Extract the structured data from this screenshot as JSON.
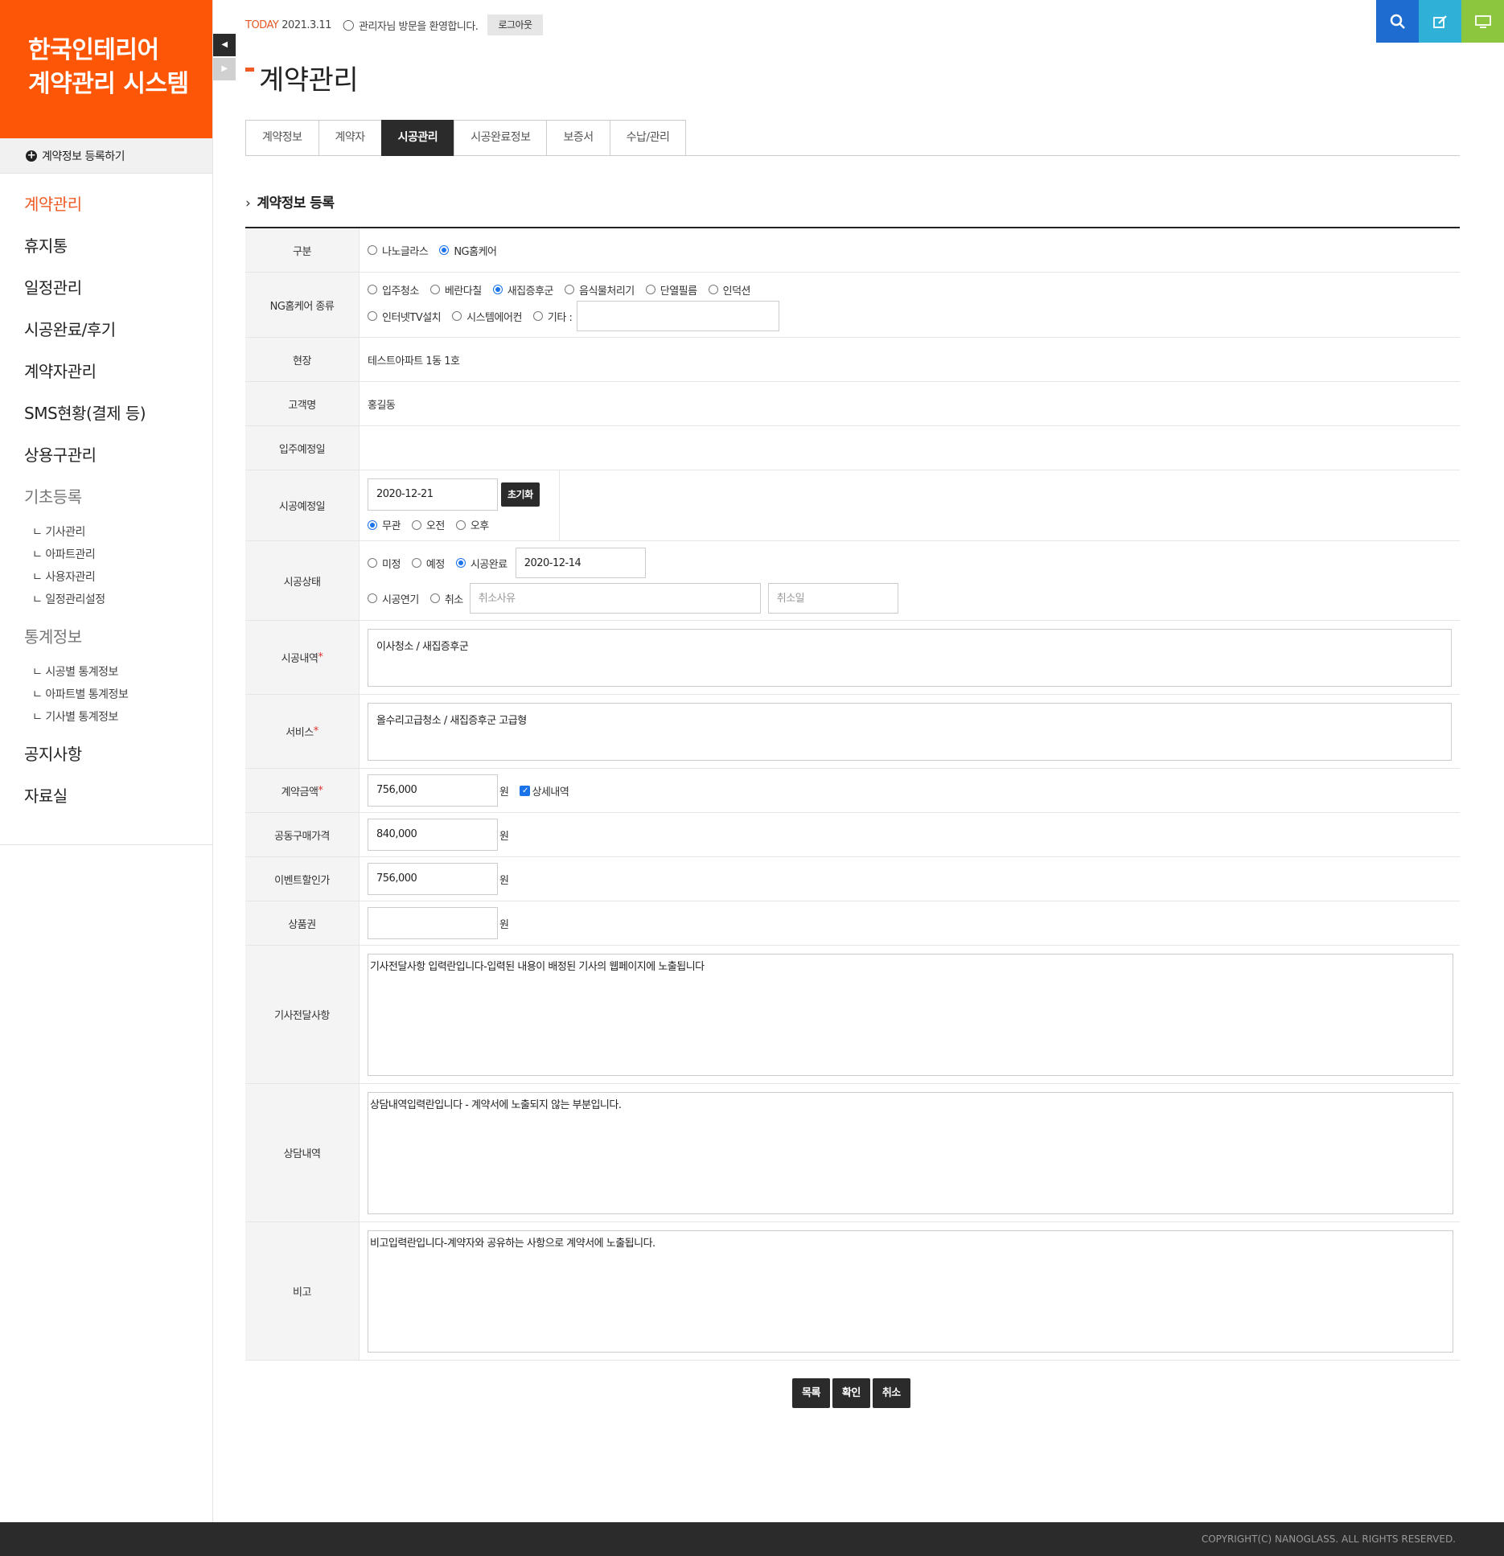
{
  "brand": {
    "line1": "한국인테리어",
    "line2": "계약관리 시스템"
  },
  "sidebar": {
    "register": "계약정보 등록하기",
    "items": [
      {
        "label": "계약관리"
      },
      {
        "label": "휴지통"
      },
      {
        "label": "일정관리"
      },
      {
        "label": "시공완료/후기"
      },
      {
        "label": "계약자관리"
      },
      {
        "label": "SMS현황(결제 등)"
      },
      {
        "label": "상용구관리"
      },
      {
        "label": "기초등록"
      }
    ],
    "basic_sub": [
      "ㄴ 기사관리",
      "ㄴ 아파트관리",
      "ㄴ 사용자관리",
      "ㄴ 일정관리설정"
    ],
    "stats": "통계정보",
    "stats_sub": [
      "ㄴ 시공별 통계정보",
      "ㄴ 아파트별 통계정보",
      "ㄴ 기사별 통계정보"
    ],
    "notice": "공지사항",
    "archive": "자료실"
  },
  "topbar": {
    "today_label": "TODAY",
    "date": "2021.3.11",
    "welcome": "관리자님 방문을 환영합니다.",
    "logout": "로그아웃"
  },
  "page_title": "계약관리",
  "tabs": [
    "계약정보",
    "계약자",
    "시공관리",
    "시공완료정보",
    "보증서",
    "수납/관리"
  ],
  "section_title": "계약정보 등록",
  "form": {
    "type": {
      "label": "구분",
      "opt1": "나노글라스",
      "opt2": "NG홈케어"
    },
    "ng_type": {
      "label": "NG홈케어 종류",
      "opts": [
        "입주청소",
        "베란다칠",
        "새집증후군",
        "음식물처리기",
        "단열필름",
        "인덕션",
        "인터넷TV설치",
        "시스템에어컨",
        "기타 :"
      ]
    },
    "site": {
      "label": "현장",
      "value": "테스트아파트 1동 1호"
    },
    "customer": {
      "label": "고객명",
      "value": "홍길동"
    },
    "move_in": {
      "label": "입주예정일"
    },
    "schedule": {
      "label": "시공예정일",
      "date": "2020-12-21",
      "reset": "초기화",
      "opts": [
        "무관",
        "오전",
        "오후"
      ]
    },
    "status": {
      "label": "시공상태",
      "opts": [
        "미정",
        "예정",
        "시공완료",
        "시공연기",
        "취소"
      ],
      "done_date": "2020-12-14",
      "cancel_reason_ph": "취소사유",
      "cancel_date_ph": "취소일"
    },
    "work": {
      "label": "시공내역",
      "value": "이사청소 / 새집증후군"
    },
    "service": {
      "label": "서비스",
      "value": "올수리고급청소 / 새집증후군 고급형"
    },
    "amount": {
      "label": "계약금액",
      "value": "756,000",
      "unit": "원",
      "detail": "상세내역"
    },
    "group_price": {
      "label": "공동구매가격",
      "value": "840,000",
      "unit": "원"
    },
    "event_price": {
      "label": "이벤트할인가",
      "value": "756,000",
      "unit": "원"
    },
    "voucher": {
      "label": "상품권",
      "unit": "원"
    },
    "tech_note": {
      "label": "기사전달사항",
      "value": "기사전달사항 입력란입니다-입력된 내용이 배정된 기사의 웹페이지에 노출됩니다"
    },
    "consult": {
      "label": "상담내역",
      "value": "상담내역입력란입니다 - 계약서에 노출되지 않는 부분입니다."
    },
    "remark": {
      "label": "비고",
      "value": "비고입력란입니다-계약자와 공유하는 사항으로 계약서에 노출됩니다."
    },
    "required": "*"
  },
  "actions": {
    "list": "목록",
    "ok": "확인",
    "cancel": "취소"
  },
  "footer": "COPYRIGHT(C) NANOGLASS. ALL RIGHTS RESERVED.",
  "colors": {
    "brand": "#fd5607",
    "active": "#f05a23",
    "dark": "#2b2b2b",
    "search": "#1f6cd1",
    "edit": "#2fb0d6",
    "monitor": "#8cc63f"
  }
}
